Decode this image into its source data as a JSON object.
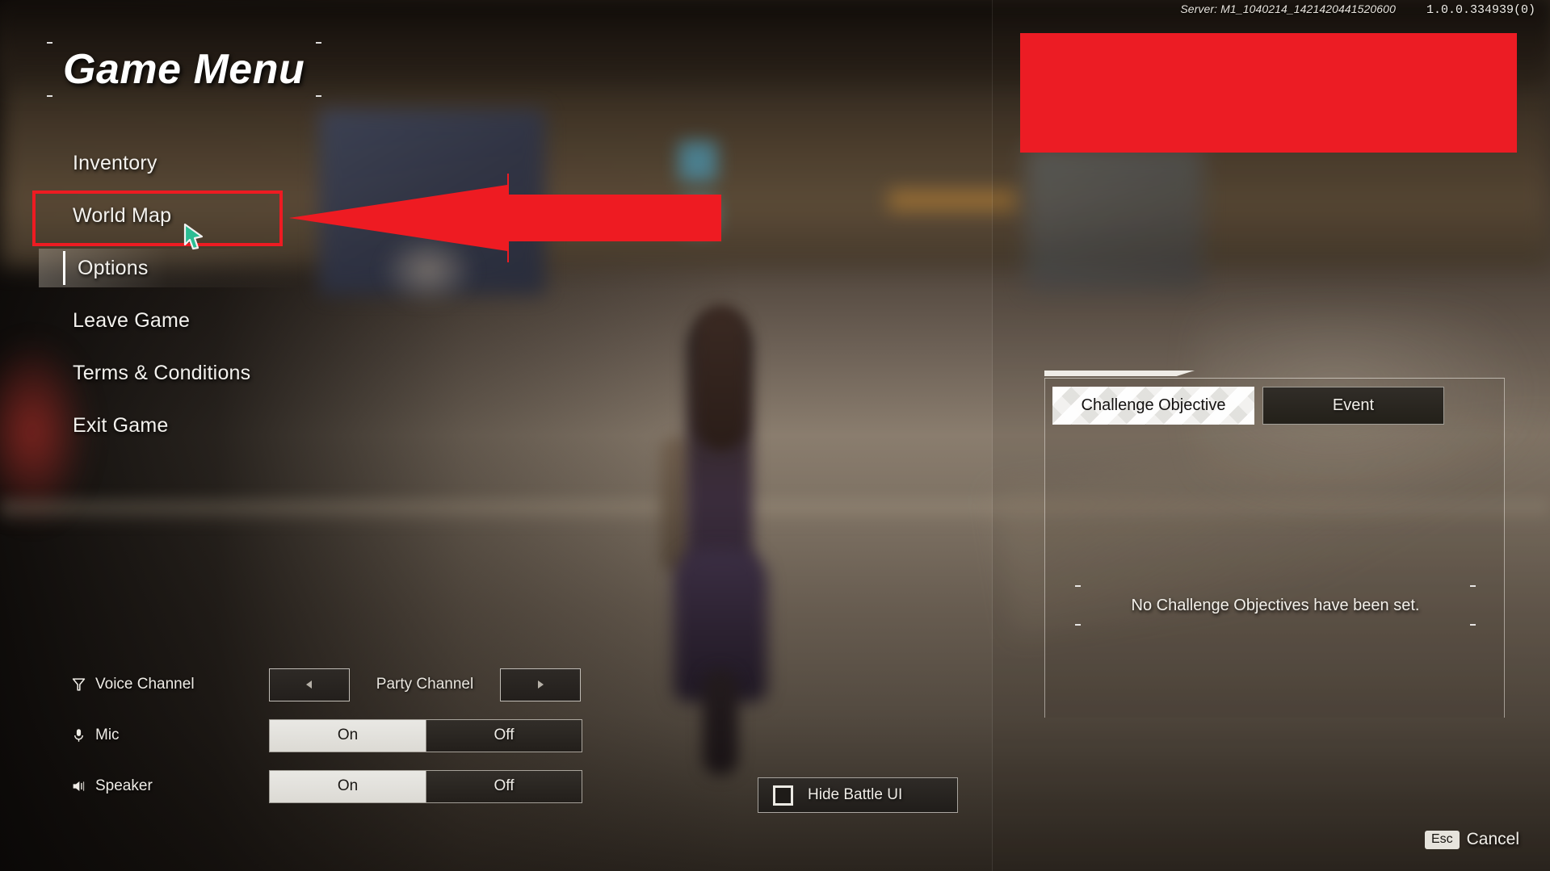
{
  "status": {
    "server": "Server: M1_1040214_1421420441520600",
    "version": "1.0.0.334939(0)"
  },
  "menu": {
    "title": "Game Menu",
    "items": [
      {
        "label": "Inventory",
        "name": "inventory",
        "selected": false
      },
      {
        "label": "World Map",
        "name": "world-map",
        "selected": false
      },
      {
        "label": "Options",
        "name": "options",
        "selected": true
      },
      {
        "label": "Leave Game",
        "name": "leave-game",
        "selected": false
      },
      {
        "label": "Terms & Conditions",
        "name": "terms-and-conditions",
        "selected": false
      },
      {
        "label": "Exit Game",
        "name": "exit-game",
        "selected": false
      }
    ]
  },
  "audio": {
    "voice_channel": {
      "label": "Voice Channel",
      "icon": "broadcast-antenna-icon",
      "prev_arrow": "◂",
      "next_arrow": "▸",
      "value": "Party Channel"
    },
    "mic": {
      "label": "Mic",
      "icon": "microphone-icon",
      "on_label": "On",
      "off_label": "Off",
      "value": "On"
    },
    "speaker": {
      "label": "Speaker",
      "icon": "speaker-icon",
      "on_label": "On",
      "off_label": "Off",
      "value": "On"
    }
  },
  "hide_battle_ui": {
    "label": "Hide Battle UI",
    "checked": false
  },
  "challenge_panel": {
    "tabs": [
      {
        "label": "Challenge Objective",
        "name": "challenge-objective",
        "active": true
      },
      {
        "label": "Event",
        "name": "event",
        "active": false
      }
    ],
    "empty_message": "No Challenge Objectives have been set."
  },
  "footer": {
    "esc_key": "Esc",
    "cancel_label": "Cancel"
  },
  "annotations": {
    "highlight_color": "#ee1b22",
    "arrow_color": "#ee1b22",
    "redaction_color": "#ec1c24",
    "cursor_color": "#2bbd93"
  }
}
